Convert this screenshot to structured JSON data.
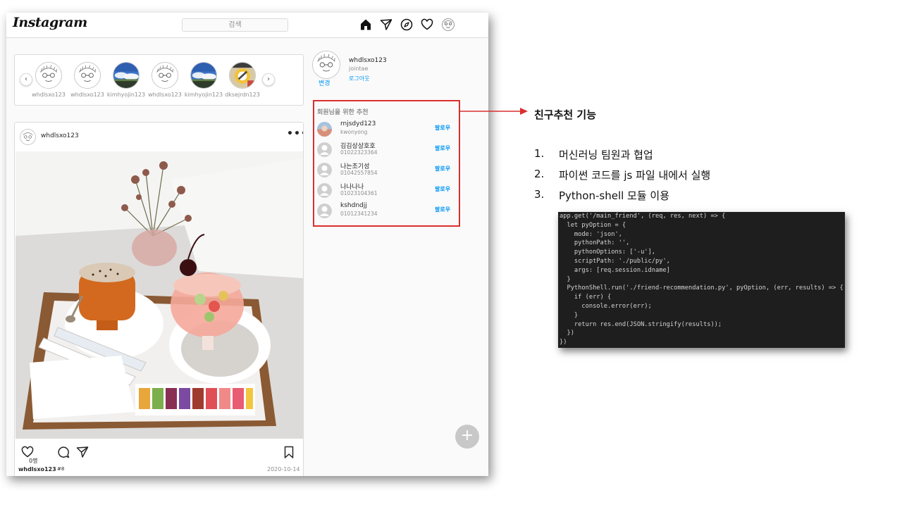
{
  "app": {
    "logo": "Instagram",
    "search_placeholder": "검색",
    "nav_icons": [
      "home-icon",
      "direct-message-icon",
      "explore-compass-icon",
      "activity-heart-icon",
      "profile-avatar-icon"
    ]
  },
  "stories": {
    "items": [
      {
        "name": "whdlsxo123",
        "avatar": "cartoon-face"
      },
      {
        "name": "whdlsxo123",
        "avatar": "cartoon-face"
      },
      {
        "name": "kimhyojin123",
        "avatar": "sky-photo"
      },
      {
        "name": "whdlsxo123",
        "avatar": "cartoon-face"
      },
      {
        "name": "kimhyojin123",
        "avatar": "sky-photo"
      },
      {
        "name": "dksejrdn123",
        "avatar": "colorful-photo"
      }
    ],
    "prev_label": "‹",
    "next_label": "›"
  },
  "post": {
    "username": "whdlsxo123",
    "more_label": "•••",
    "likes": "0명",
    "footer_user": "whdlsxo123",
    "tag": "#8",
    "date": "2020-10-14"
  },
  "profile": {
    "id": "whdlsxo123",
    "name": "jointae",
    "change_label": "변경",
    "logout_label": "로그아웃"
  },
  "recommend": {
    "title": "회원님을 위한 추천",
    "follow_label": "팔로우",
    "items": [
      {
        "id": "rnjsdyd123",
        "sub": "kwonyong",
        "avatar": "photo"
      },
      {
        "id": "김김상상호호",
        "sub": "01022323364",
        "avatar": "default"
      },
      {
        "id": "나는조기성",
        "sub": "01042557854",
        "avatar": "default"
      },
      {
        "id": "나나나나",
        "sub": "01023104361",
        "avatar": "default"
      },
      {
        "id": "kshdndjj",
        "sub": "01012341234",
        "avatar": "default"
      }
    ]
  },
  "fab_label": "+",
  "annotation": {
    "title": "친구추천 기능",
    "items": [
      {
        "num": "1.",
        "text": "머신러닝 팀원과 협업"
      },
      {
        "num": "2.",
        "text": "파이썬 코드를 js 파일 내에서 실행"
      },
      {
        "num": "3.",
        "text": "Python-shell  모듈 이용"
      }
    ],
    "highlight_color": "#d92f2f"
  },
  "code": {
    "lines": [
      "app.get('/main_friend', (req, res, next) => {",
      "  let pyOption = {",
      "    mode: 'json',",
      "    pythonPath: '',",
      "    pythonOptions: ['-u'],",
      "    scriptPath: './public/py',",
      "    args: [req.session.idname]",
      "  }",
      "  PythonShell.run('./friend-recommendation.py', pyOption, (err, results) => {",
      "    if (err) {",
      "      console.error(err);",
      "    }",
      "    return res.end(JSON.stringify(results));",
      "  })",
      "})"
    ]
  }
}
